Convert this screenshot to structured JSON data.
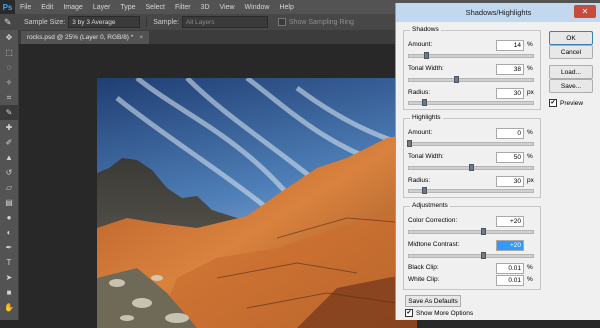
{
  "app": {
    "logo": "Ps",
    "menu": [
      "File",
      "Edit",
      "Image",
      "Layer",
      "Type",
      "Select",
      "Filter",
      "3D",
      "View",
      "Window",
      "Help"
    ]
  },
  "options_bar": {
    "tool_icon": "eyedropper-icon",
    "sample_size_label": "Sample Size:",
    "sample_size_value": "3 by 3 Average",
    "sample_label": "Sample:",
    "sample_value": "All Layers",
    "show_ring_label": "Show Sampling Ring"
  },
  "document_tab": {
    "title": "rocks.psd @ 25% (Layer 0, RGB/8) *",
    "close": "×"
  },
  "tools": [
    "move-icon",
    "marquee-icon",
    "lasso-icon",
    "quick-select-icon",
    "crop-icon",
    "eyedropper-icon",
    "healing-icon",
    "brush-icon",
    "stamp-icon",
    "history-brush-icon",
    "eraser-icon",
    "gradient-icon",
    "blur-icon",
    "dodge-icon",
    "pen-icon",
    "type-icon",
    "path-select-icon",
    "shape-icon",
    "hand-icon"
  ],
  "dialog": {
    "title": "Shadows/Highlights",
    "close": "✕",
    "shadows": {
      "title": "Shadows",
      "amount_label": "Amount:",
      "amount_value": "14",
      "amount_unit": "%",
      "amount_fraction": 0.14,
      "tonal_label": "Tonal Width:",
      "tonal_value": "38",
      "tonal_unit": "%",
      "tonal_fraction": 0.38,
      "radius_label": "Radius:",
      "radius_value": "30",
      "radius_unit": "px",
      "radius_fraction": 0.12
    },
    "highlights": {
      "title": "Highlights",
      "amount_label": "Amount:",
      "amount_value": "0",
      "amount_unit": "%",
      "amount_fraction": 0.0,
      "tonal_label": "Tonal Width:",
      "tonal_value": "50",
      "tonal_unit": "%",
      "tonal_fraction": 0.5,
      "radius_label": "Radius:",
      "radius_value": "30",
      "radius_unit": "px",
      "radius_fraction": 0.12
    },
    "adjustments": {
      "title": "Adjustments",
      "color_label": "Color Correction:",
      "color_value": "+20",
      "color_fraction": 0.6,
      "midtone_label": "Midtone Contrast:",
      "midtone_value": "+20",
      "midtone_fraction": 0.6,
      "black_label": "Black Clip:",
      "black_value": "0.01",
      "black_unit": "%",
      "white_label": "White Clip:",
      "white_value": "0.01",
      "white_unit": "%"
    },
    "buttons": {
      "ok": "OK",
      "cancel": "Cancel",
      "load": "Load...",
      "save": "Save..."
    },
    "preview_label": "Preview",
    "preview_checked": true,
    "save_defaults": "Save As Defaults",
    "show_more_label": "Show More Options",
    "show_more_checked": true
  }
}
